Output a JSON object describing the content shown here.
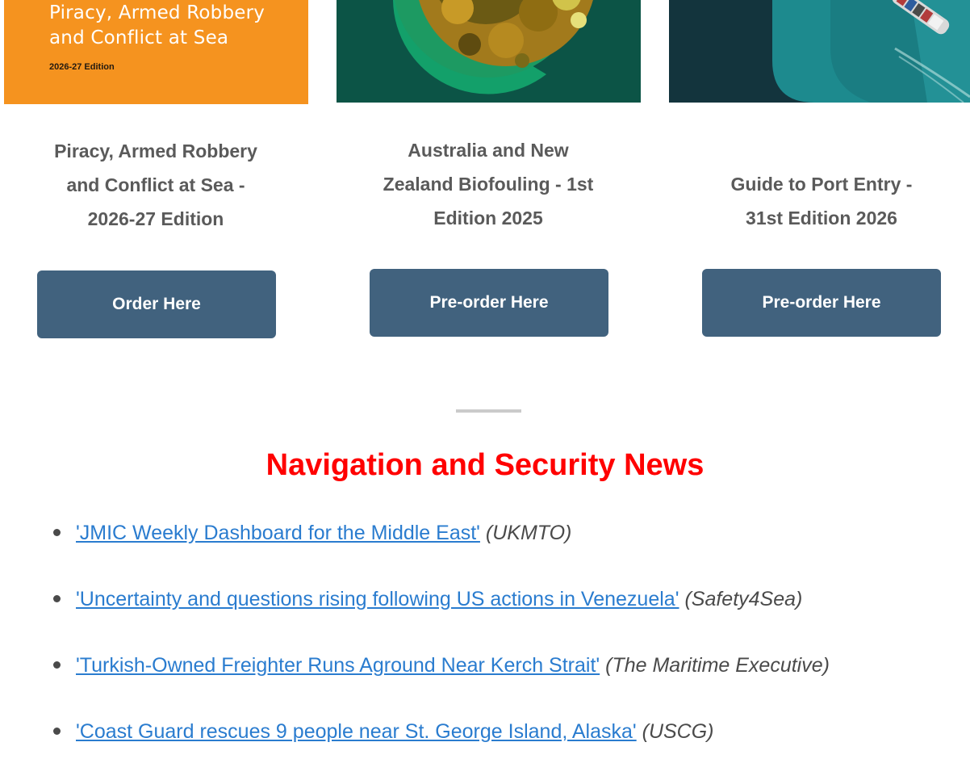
{
  "covers": {
    "cover1": {
      "title_lines": [
        "Piracy, Armed Robbery",
        "and Conflict at Sea"
      ],
      "edition": "2026-27 Edition",
      "color": "#f5931f"
    },
    "cover2": {
      "color": "#0c5446"
    },
    "cover3": {
      "color": "#13343d"
    }
  },
  "books": [
    {
      "title_lines": [
        "Piracy, Armed Robbery",
        "and Conflict at Sea -",
        "2026-27 Edition"
      ],
      "button": "Order Here"
    },
    {
      "title_lines": [
        "Australia and New",
        "Zealand Biofouling - 1st",
        "Edition 2025"
      ],
      "button": "Pre-order Here"
    },
    {
      "title_lines": [
        "Guide to Port Entry -",
        "31st Edition 2026"
      ],
      "button": "Pre-order Here"
    }
  ],
  "button_color": "#41627e",
  "news": {
    "heading": "Navigation and Security News",
    "heading_color": "#ff0000",
    "items": [
      {
        "link": "'JMIC Weekly Dashboard for the Middle East'",
        "source": "(UKMTO)"
      },
      {
        "link": "'Uncertainty and questions rising following US actions in Venezuela'",
        "source": "(Safety4Sea)"
      },
      {
        "link": "'Turkish-Owned Freighter Runs Aground Near Kerch Strait'",
        "source": "(The Maritime Executive)"
      },
      {
        "link": "'Coast Guard rescues 9 people near St. George Island, Alaska'",
        "source": "(USCG)"
      }
    ]
  }
}
